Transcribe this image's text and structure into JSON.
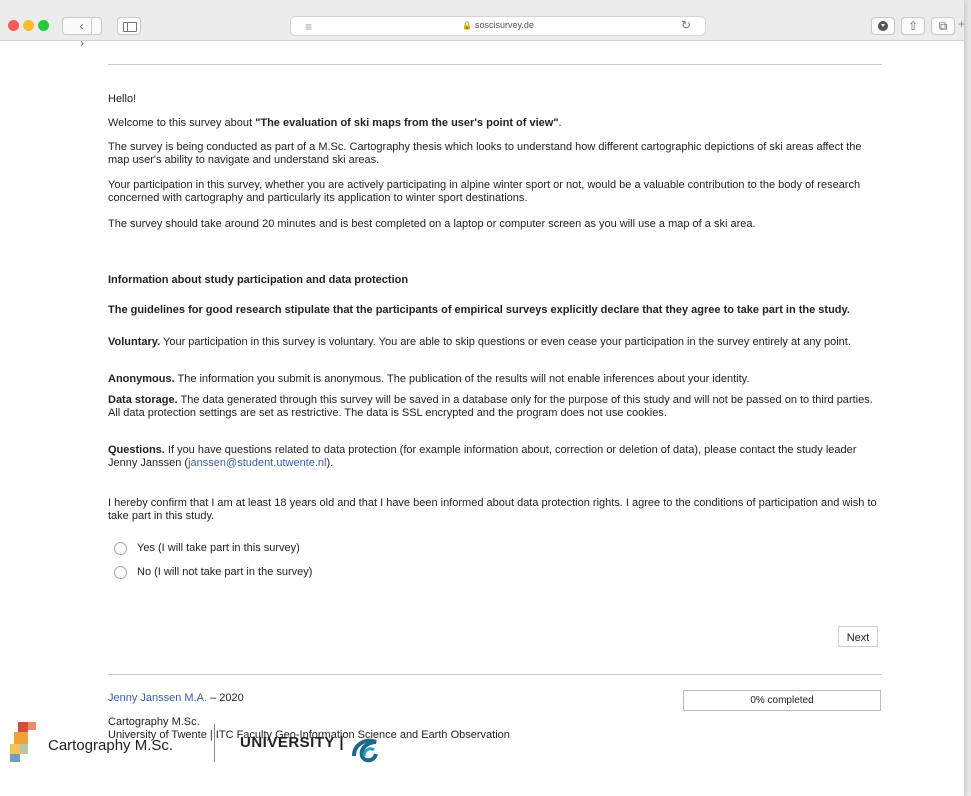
{
  "browser": {
    "url": "soscisurvey.de",
    "back_glyph": "‹",
    "forward_glyph": "›",
    "reader_glyph": "≡",
    "reload_glyph": "↻",
    "share_glyph": "⇧",
    "tabs_glyph": "⧉",
    "plus_glyph": "+",
    "icons": [
      "back-icon",
      "forward-icon",
      "sidebar-icon",
      "reader-icon",
      "lock-icon",
      "reload-icon",
      "download-icon",
      "share-icon",
      "tabs-icon"
    ]
  },
  "intro": {
    "hello": "Hello!",
    "welcome_prefix": "Welcome to this survey about ",
    "welcome_title": "\"The evaluation of ski maps from the user's point of view\"",
    "welcome_suffix": ".",
    "p1": "The survey is being conducted as part of a M.Sc. Cartography thesis which looks to understand how different cartographic depictions of ski areas affect the map user's ability to navigate and understand ski areas.",
    "p2": "Your participation in this survey, whether you are actively participating in alpine winter sport or not, would be a valuable contribution to the body of research concerned with cartography and particularly its application to winter sport destinations.",
    "p3": "The survey should take around 20 minutes and is best completed on a laptop or computer screen as you will use a map of a ski area."
  },
  "protection": {
    "heading": "Information about study participation and data protection",
    "guidelines": "The guidelines for good research stipulate that the participants of empirical surveys explicitly declare that they agree to take part in the study.",
    "voluntary_label": "Voluntary.",
    "voluntary_text": " Your participation in this survey is voluntary. You are able to skip questions or even cease your participation in the survey entirely at any point.",
    "anonymous_label": "Anonymous.",
    "anonymous_text": " The information you submit is anonymous. The publication of the results will not enable inferences about your identity.",
    "storage_label": "Data storage.",
    "storage_text": " The data generated through this survey will be saved in a database only for the purpose of this study and will not be passed on to third parties. All data protection settings are set as restrictive. The data is SSL encrypted and the program does not use cookies.",
    "questions_label": "Questions.",
    "questions_text": " If you have questions related to data protection (for example information about, correction or deletion of data), please contact the study leader Jenny Janssen (",
    "email": "janssen@student.utwente.nl",
    "questions_end": ")."
  },
  "consent": {
    "statement": "I hereby confirm that I am at least 18 years old and that I have been informed about data protection rights. I agree to the conditions of participation and wish to take part in this study.",
    "options": [
      "Yes (I will take part in this survey)",
      "No (I will not take part in the survey)"
    ]
  },
  "next_label": "Next",
  "footer": {
    "author": "Jenny Janssen M.A.",
    "year_suffix": " – 2020",
    "program": "Cartography M.Sc.",
    "institution": "University of Twente | ITC Faculty Geo-Information Science and Earth Observation",
    "progress_percent": 0,
    "progress_label": "0% completed",
    "logo_cartography": "Cartography M.Sc.",
    "logo_university": "UNIVERSITY |"
  }
}
